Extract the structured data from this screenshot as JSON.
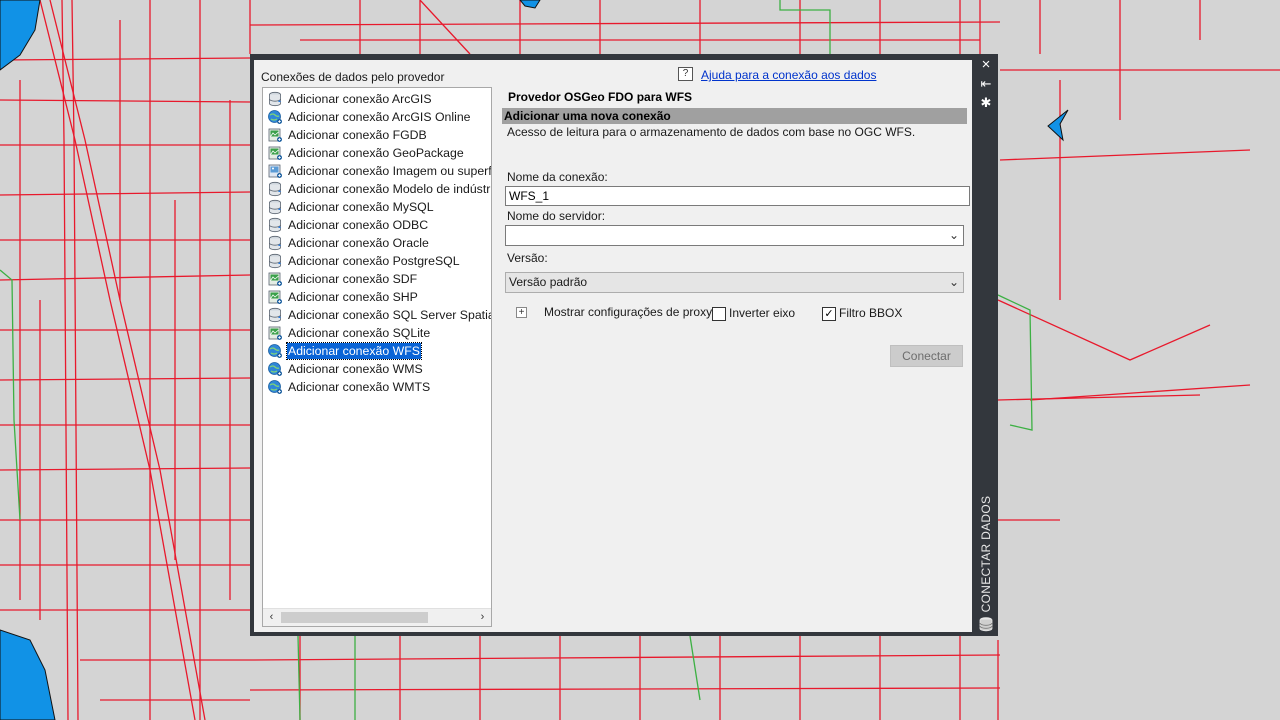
{
  "sidebar": {
    "header": "Conexões de dados pelo provedor",
    "items": [
      {
        "label": "Adicionar conexão ArcGIS",
        "icon": "db-cylinder-icon"
      },
      {
        "label": "Adicionar conexão ArcGIS Online",
        "icon": "globe-icon"
      },
      {
        "label": "Adicionar conexão FGDB",
        "icon": "file-raster-icon"
      },
      {
        "label": "Adicionar conexão GeoPackage",
        "icon": "file-raster-icon"
      },
      {
        "label": "Adicionar conexão Imagem ou superfície",
        "icon": "file-image-icon"
      },
      {
        "label": "Adicionar conexão Modelo de indústria",
        "icon": "db-cylinder-icon"
      },
      {
        "label": "Adicionar conexão MySQL",
        "icon": "db-cylinder-icon"
      },
      {
        "label": "Adicionar conexão ODBC",
        "icon": "db-cylinder-icon"
      },
      {
        "label": "Adicionar conexão Oracle",
        "icon": "db-cylinder-icon"
      },
      {
        "label": "Adicionar conexão PostgreSQL",
        "icon": "db-cylinder-icon"
      },
      {
        "label": "Adicionar conexão SDF",
        "icon": "file-raster-icon"
      },
      {
        "label": "Adicionar conexão SHP",
        "icon": "file-raster-icon"
      },
      {
        "label": "Adicionar conexão SQL Server Spatial",
        "icon": "db-cylinder-icon"
      },
      {
        "label": "Adicionar conexão SQLite",
        "icon": "file-raster-icon"
      },
      {
        "label": "Adicionar conexão WFS",
        "icon": "globe-icon",
        "selected": true
      },
      {
        "label": "Adicionar conexão WMS",
        "icon": "globe-icon"
      },
      {
        "label": "Adicionar conexão WMTS",
        "icon": "globe-icon"
      }
    ]
  },
  "help": {
    "question_glyph": "?",
    "link": "Ajuda para a conexão aos dados"
  },
  "panel": {
    "title": "Provedor OSGeo FDO para WFS",
    "section": "Adicionar uma nova conexão",
    "description": "Acesso de leitura para o armazenamento de dados com base no OGC WFS.",
    "connection_name_label": "Nome da conexão:",
    "connection_name_value": "WFS_1",
    "server_label": "Nome do servidor:",
    "server_value": "",
    "version_label": "Versão:",
    "version_value": "Versão padrão",
    "proxy_label": "Mostrar configurações de proxy",
    "invert_axis_label": "Inverter eixo",
    "invert_axis_checked": false,
    "bbox_filter_label": "Filtro BBOX",
    "bbox_filter_checked": true,
    "connect_button": "Conectar"
  },
  "palette": {
    "title": "CONECTAR DADOS"
  },
  "colors": {
    "accent": "#0a64d6",
    "map_road": "#e8192c",
    "map_boundary": "#3cb043",
    "map_water": "#1192e6"
  }
}
